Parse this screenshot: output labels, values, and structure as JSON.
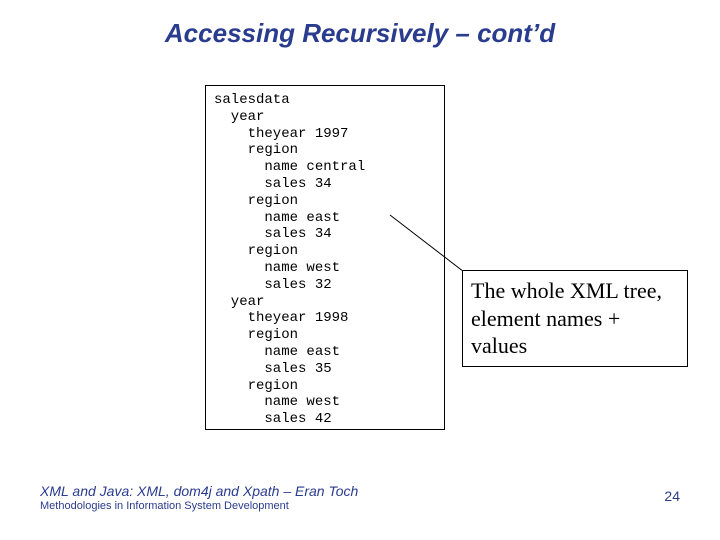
{
  "title": "Accessing Recursively – cont’d",
  "code": "salesdata\n  year\n    theyear 1997\n    region\n      name central\n      sales 34\n    region\n      name east\n      sales 34\n    region\n      name west\n      sales 32\n  year\n    theyear 1998\n    region\n      name east\n      sales 35\n    region\n      name west\n      sales 42",
  "callout": "The whole XML tree, element names + values",
  "footer": {
    "line1": "XML and Java: XML, dom4j and Xpath – Eran Toch",
    "line2": "Methodologies in Information System Development"
  },
  "page_number": "24"
}
